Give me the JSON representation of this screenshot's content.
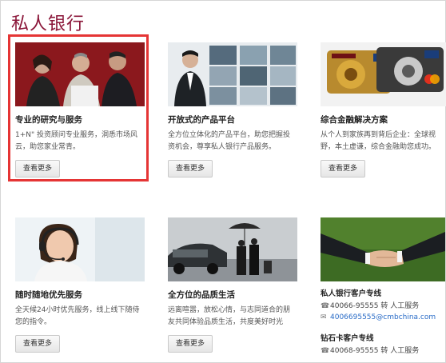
{
  "page_title": "私人银行",
  "cards": [
    {
      "title": "专业的研究与服务",
      "desc": "1+N\" 投资顾问专业服务，洞悉市场风云，助您家业常青。",
      "button": "查看更多"
    },
    {
      "title": "开放式的产品平台",
      "desc": "全方位立体化的产品平台，助您把握投资机会，尊享私人银行产品服务。",
      "button": "查看更多"
    },
    {
      "title": "综合金融解决方案",
      "desc": "从个人到家族再到背后企业：全球视野，本土虚谦，综合金融助您成功。",
      "button": "查看更多"
    },
    {
      "title": "随时随地优先服务",
      "desc": "全天候24小时优先服务，线上线下随侍您的指令。",
      "button": "查看更多"
    },
    {
      "title": "全方位的品质生活",
      "desc": "远离喧嚣，放松心情，与志同道合的朋友共同体验品质生活，共度美好时光",
      "button": "查看更多"
    }
  ],
  "contact": {
    "pb_title": "私人银行客户专线",
    "pb_phone": "40066-95555 转 人工服务",
    "pb_email": "4006695555@cmbchina.com",
    "diamond_title": "钻石卡客户专线",
    "diamond_phone": "40068-95555 转 人工服务"
  },
  "colors": {
    "brand": "#8a1538",
    "highlight": "#e53535",
    "link": "#2a6cc7"
  },
  "icons": {
    "phone": "phone-icon",
    "mail": "mail-icon"
  }
}
